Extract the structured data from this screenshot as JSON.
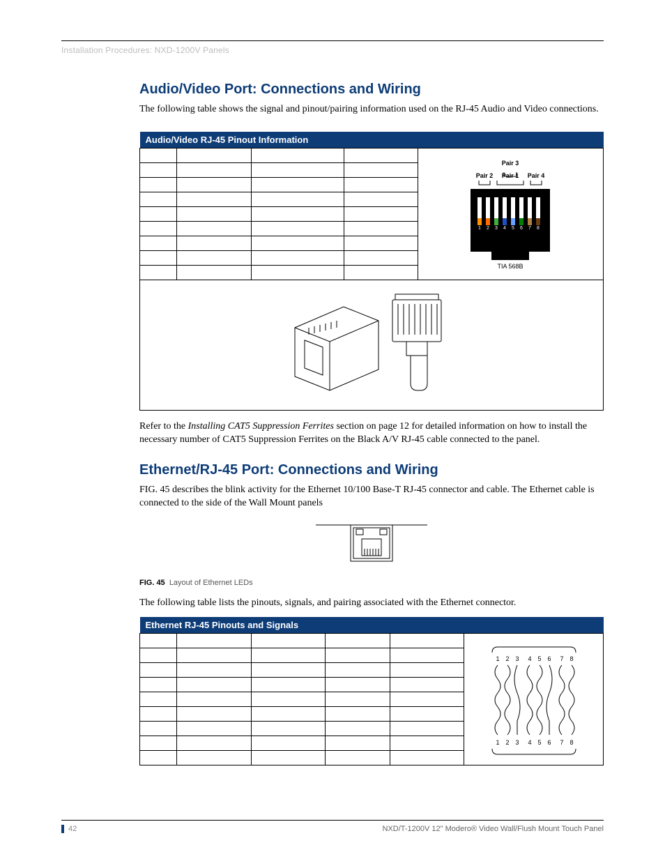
{
  "header": {
    "breadcrumb": "Installation Procedures: NXD-1200V Panels"
  },
  "section1": {
    "title": "Audio/Video Port: Connections and Wiring",
    "intro": "The following table shows the signal and pinout/pairing information used on the RJ-45 Audio and Video connections.",
    "table_title": "Audio/Video RJ-45 Pinout Information",
    "diagram": {
      "pair1": "Pair 1",
      "pair2": "Pair 2",
      "pair3": "Pair 3",
      "pair4": "Pair 4",
      "std": "TIA 568B",
      "pins": [
        "1",
        "2",
        "3",
        "4",
        "5",
        "6",
        "7",
        "8"
      ]
    },
    "note_pre": "Refer to the ",
    "note_italic": "Installing CAT5 Suppression Ferrites",
    "note_post": " section on page 12 for detailed information on how to install the necessary number of CAT5 Suppression Ferrites on the Black A/V RJ-45 cable connected to the panel."
  },
  "section2": {
    "title": "Ethernet/RJ-45 Port: Connections and Wiring",
    "intro": "FIG. 45 describes the blink activity for the Ethernet 10/100 Base-T RJ-45 connector and cable. The Ethernet cable is connected to the side of the Wall Mount panels",
    "fig_label": "FIG. 45",
    "fig_caption": "Layout of Ethernet LEDs",
    "post_fig": "The following table lists the pinouts, signals, and pairing associated with the Ethernet connector.",
    "table_title": "Ethernet RJ-45 Pinouts and Signals",
    "pins_top": [
      "1",
      "2",
      "3",
      "4",
      "5",
      "6",
      "7",
      "8"
    ],
    "pins_bottom": [
      "1",
      "2",
      "3",
      "4",
      "5",
      "6",
      "7",
      "8"
    ]
  },
  "footer": {
    "page": "42",
    "doc": "NXD/T-1200V 12\" Modero® Video Wall/Flush Mount Touch Panel"
  }
}
